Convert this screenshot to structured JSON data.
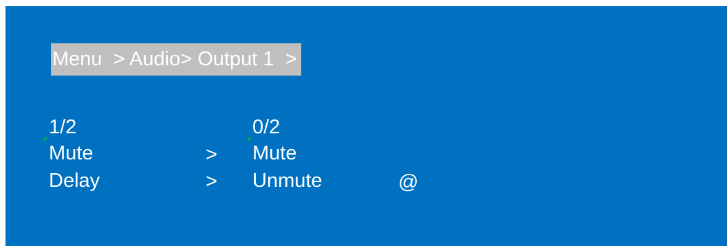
{
  "colors": {
    "screen_bg": "#0070c0",
    "breadcrumb_bg": "#bfbfbf",
    "text": "#ffffff",
    "cursor_marker": "#00b050"
  },
  "breadcrumb": "Menu  > Audio> Output 1  >",
  "left_column": {
    "page": "1/2",
    "items": [
      "Mute",
      "Delay"
    ],
    "arrows": [
      ">",
      ">"
    ]
  },
  "right_column": {
    "page": "0/2",
    "options": [
      "Mute",
      "Unmute"
    ],
    "selected_marker": "@"
  }
}
